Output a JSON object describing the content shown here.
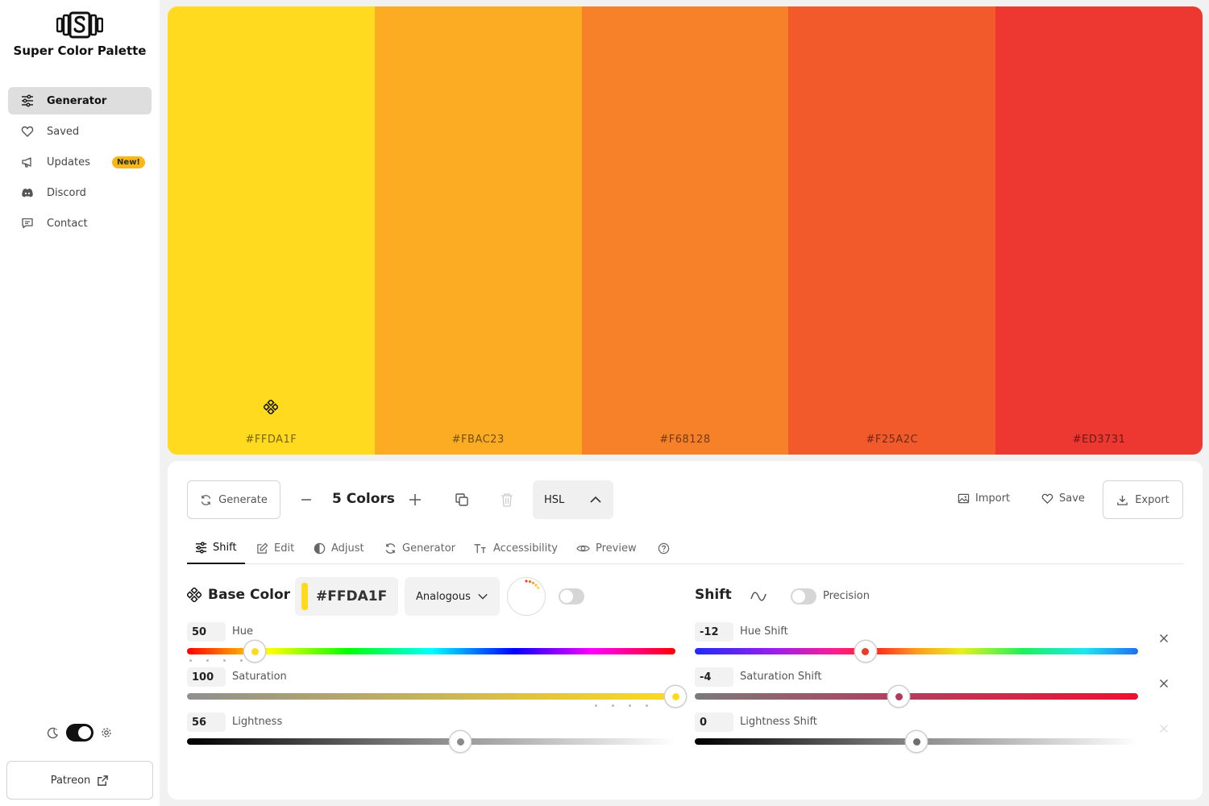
{
  "app": {
    "title": "Super Color Palette"
  },
  "nav": {
    "items": [
      {
        "label": "Generator",
        "icon": "sliders-icon",
        "active": true
      },
      {
        "label": "Saved",
        "icon": "heart-icon"
      },
      {
        "label": "Updates",
        "icon": "megaphone-icon",
        "badge": "New!"
      },
      {
        "label": "Discord",
        "icon": "discord-icon"
      },
      {
        "label": "Contact",
        "icon": "message-icon"
      }
    ]
  },
  "patreon": {
    "label": "Patreon"
  },
  "palette": {
    "colors": [
      {
        "hex": "#FFDA1F",
        "base": true
      },
      {
        "hex": "#FBAC23"
      },
      {
        "hex": "#F68128"
      },
      {
        "hex": "#F25A2C"
      },
      {
        "hex": "#ED3731"
      }
    ]
  },
  "toolbar": {
    "generate_label": "Generate",
    "count_label": "5 Colors",
    "mode": "HSL",
    "import_label": "Import",
    "save_label": "Save",
    "export_label": "Export"
  },
  "tabs": [
    {
      "label": "Shift",
      "active": true
    },
    {
      "label": "Edit"
    },
    {
      "label": "Adjust"
    },
    {
      "label": "Generator"
    },
    {
      "label": "Accessibility"
    },
    {
      "label": "Preview"
    }
  ],
  "base": {
    "title": "Base Color",
    "hex": "#FFDA1F",
    "scheme": "Analogous",
    "sliders": [
      {
        "label": "Hue",
        "value": "50",
        "fraction": 0.139
      },
      {
        "label": "Saturation",
        "value": "100",
        "fraction": 1.0
      },
      {
        "label": "Lightness",
        "value": "56",
        "fraction": 0.56
      }
    ]
  },
  "shift": {
    "title": "Shift",
    "precision_label": "Precision",
    "sliders": [
      {
        "label": "Hue Shift",
        "value": "-12",
        "fraction": 0.385
      },
      {
        "label": "Saturation Shift",
        "value": "-4",
        "fraction": 0.46
      },
      {
        "label": "Lightness Shift",
        "value": "0",
        "fraction": 0.5
      }
    ]
  }
}
